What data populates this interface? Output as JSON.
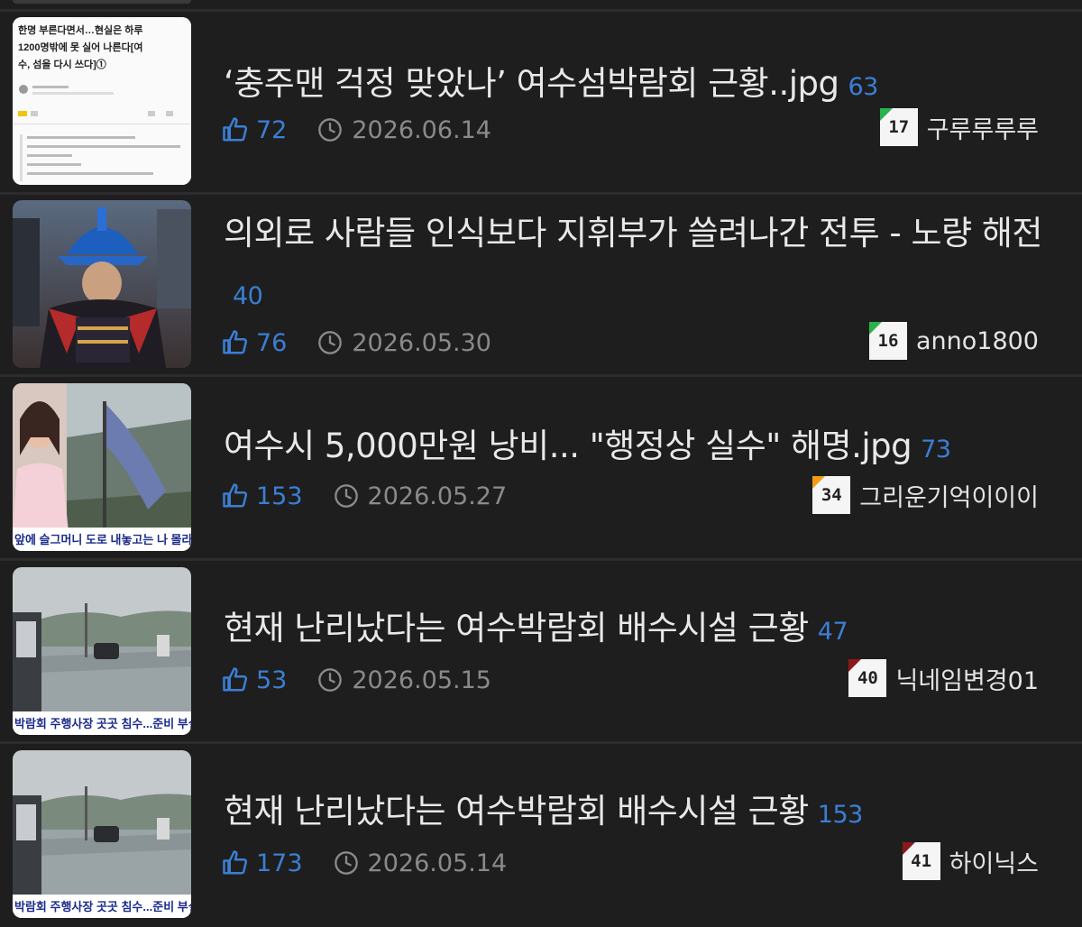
{
  "posts": [
    {
      "title": "‘충주맨 걱정 맞았나’ 여수섬박람회 근황..jpg",
      "comments": "63",
      "likes": "72",
      "date": "2026.06.14",
      "author": "구루루루루",
      "level": "17",
      "level_color": "#2bb24c",
      "thumb_text": [
        "한명 부른다면서…현실은 하루",
        "1200명밖에 못 실어 나른다[여",
        "수, 섬을 다시 쓰다]①"
      ]
    },
    {
      "title": "의외로 사람들 인식보다 지휘부가 쓸려나간 전투 - 노량 해전",
      "comments": "40",
      "likes": "76",
      "date": "2026.05.30",
      "author": "anno1800",
      "level": "16",
      "level_color": "#2bb24c"
    },
    {
      "title": "여수시 5,000만원 낭비... \"행정상 실수\" 해명.jpg",
      "comments": "73",
      "likes": "153",
      "date": "2026.05.27",
      "author": "그리운기억이이이",
      "level": "34",
      "level_color": "#f39c12",
      "thumb_caption": "앞에 슬그머니 도로 내놓고는 나 몰라"
    },
    {
      "title": "현재 난리났다는 여수박람회 배수시설 근황",
      "comments": "47",
      "likes": "53",
      "date": "2026.05.15",
      "author": "닉네임변경01",
      "level": "40",
      "level_color": "#8b1a1a",
      "thumb_caption": "박람회 주행사장 곳곳 침수...준비 부실 논"
    },
    {
      "title": "현재 난리났다는 여수박람회 배수시설 근황",
      "comments": "153",
      "likes": "173",
      "date": "2026.05.14",
      "author": "하이닉스",
      "level": "41",
      "level_color": "#8b1a1a",
      "thumb_caption": "박람회 주행사장 곳곳 침수...준비 부실 논"
    }
  ]
}
